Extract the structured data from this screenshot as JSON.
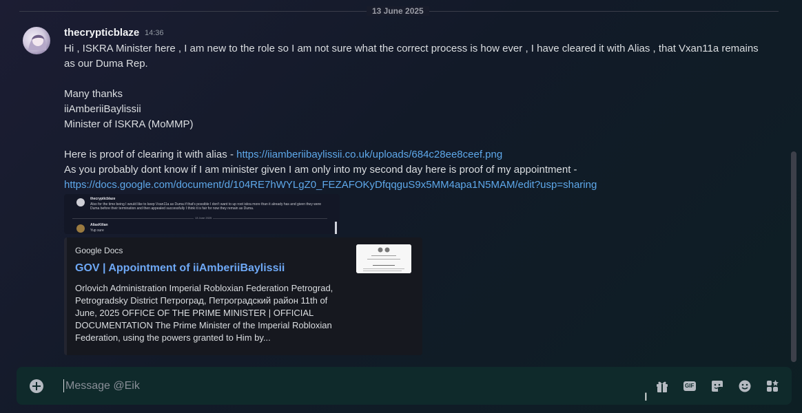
{
  "divider": {
    "date": "13 June 2025"
  },
  "message": {
    "author": "thecrypticblaze",
    "time": "14:36",
    "lines": [
      "Hi , ISKRA Minister here , I am new to the role so I am not sure what the correct process is how ever , I have cleared it with Alias , that Vxan11a remains as our Duma Rep.",
      "",
      "Many thanks",
      "iiAmberiiBaylissii",
      "Minister of ISKRA (MoMMP)",
      ""
    ],
    "proof_text": "Here is proof of clearing it with alias - ",
    "proof_link": "https://iiamberiibaylissii.co.uk/uploads/684c28ee8ceef.png",
    "appointment_text": "As you probably dont know if I am minister given I am only into my second day here is proof of my appointment -",
    "appointment_link": "https://docs.google.com/document/d/104RE7hWYLgZ0_FEZAFOKyDfqqguS9x5MM4apa1N5MAM/edit?usp=sharing"
  },
  "screenshot_preview": {
    "author1": "thecrypticblaze",
    "text1": "Also for the time being I would like to keep Vxan11a as Duma if that's possible I don't want to up root iskra more than it already has and given they were Duma before their termination and then appealed successfully I think it is fair for now they remain as Duma.",
    "date": "13 June 2025",
    "author2": "AliasKilian",
    "text2": "Yup sure"
  },
  "embed": {
    "provider": "Google Docs",
    "title": "GOV | Appointment of iiAmberiiBaylissii",
    "description": "Orlovich Administration Imperial Robloxian Federation Petrograd, Petrogradsky District Петроград, Петроградский район 11th of June, 2025 OFFICE OF THE PRIME MINISTER | OFFICIAL DOCUMENTATION The Prime Minister of the Imperial Robloxian Federation, using the powers granted to Him by..."
  },
  "composer": {
    "placeholder": "Message @Eik",
    "icons": [
      "add-icon",
      "gift-icon",
      "gif-icon",
      "sticker-icon",
      "emoji-icon",
      "apps-icon"
    ],
    "gif_label": "GIF"
  },
  "colors": {
    "link": "#5ea8ea",
    "embed_title": "#6ea8f5",
    "composer_bg": "#0f2a2b"
  }
}
